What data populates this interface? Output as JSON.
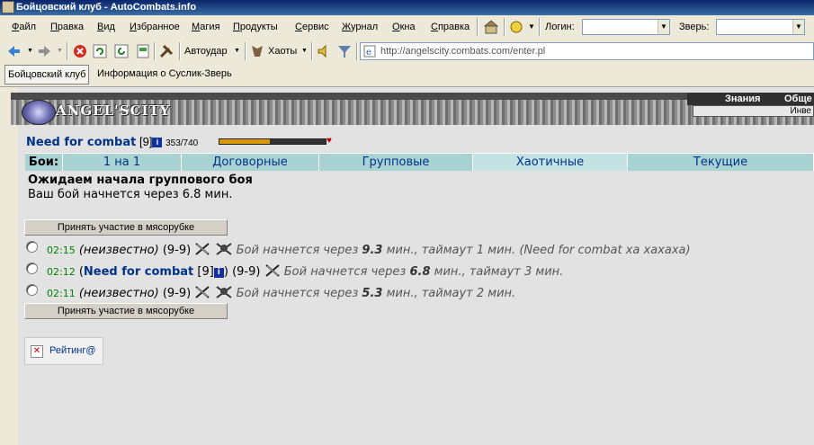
{
  "window": {
    "title": "Бойцовский клуб - AutoCombats.info"
  },
  "menu": {
    "items": [
      "Файл",
      "Правка",
      "Вид",
      "Избранное",
      "Магия",
      "Продукты",
      "Сервис",
      "Журнал",
      "Окна",
      "Справка"
    ],
    "login_label": "Логин:",
    "beast_label": "Зверь:"
  },
  "toolbar": {
    "autoudar": "Автоудар",
    "haoty": "Хаоты",
    "address": "http://angelscity.combats.com/enter.pl"
  },
  "tabs": [
    "Бойцовский клуб",
    "Информация о Суслик-Зверь"
  ],
  "site": {
    "logo": "ANGEL'SCITY",
    "nav_knowledge": "Знания",
    "nav_common": "Обще",
    "nav_inv": "Инве"
  },
  "user": {
    "nick": "Need for combat",
    "level": "[9]",
    "info_icon": "i",
    "hp": "353/740",
    "hp_fraction": 0.477
  },
  "fight_tabs": {
    "label": "Бои:",
    "items": [
      "1 на 1",
      "Договорные",
      "Групповые",
      "Хаотичные",
      "Текущие"
    ],
    "selected": 3
  },
  "status": {
    "line1": "Ожидаем начала группового боя",
    "line2": "Ваш бой начнется через 6.8 мин."
  },
  "join_button": "Принять участие в мясорубке",
  "battles": [
    {
      "time": "02:15",
      "owner": "(неизвестно)",
      "levels": "(9-9)",
      "prefix": "Бой начнется через",
      "minutes": "9.3",
      "suffix": "мин., таймаут 1 мин. (Need for combat ха хахаха)"
    },
    {
      "time": "02:12",
      "owner": "Need for combat",
      "owner_level": "[9]",
      "levels": "(9-9)",
      "prefix": "Бой начнется через",
      "minutes": "6.8",
      "suffix": "мин., таймаут 3 мин."
    },
    {
      "time": "02:11",
      "owner": "(неизвестно)",
      "levels": "(9-9)",
      "prefix": "Бой начнется через",
      "minutes": "5.3",
      "suffix": "мин., таймаут 2 мин."
    }
  ],
  "rating": {
    "label": "Рейтинг@"
  }
}
